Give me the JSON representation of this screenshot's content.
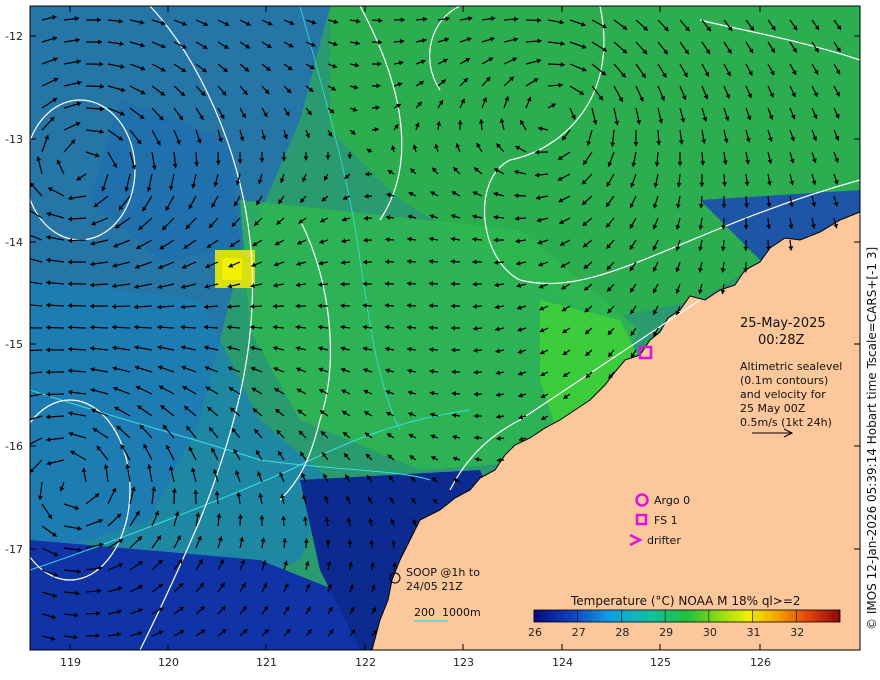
{
  "colors": {
    "land": "#fcc89b",
    "sst_low": "#0a2a8a",
    "sst_mid": "#2aa84a",
    "sst_high": "#e8e000",
    "contour": "#ffffff",
    "bathy": "#38e0e0",
    "marker": "#e010e0",
    "arrow": "#000000"
  },
  "axes": {
    "lat_ticks": [
      "-12",
      "-13",
      "-14",
      "-15",
      "-16",
      "-17"
    ],
    "lon_ticks": [
      "119",
      "120",
      "121",
      "122",
      "123",
      "124",
      "125",
      "126"
    ]
  },
  "stamp": {
    "date": "25-May-2025",
    "time": "00:28Z"
  },
  "altimetry_note": {
    "line1": "Altimetric sealevel",
    "line2": "(0.1m contours)",
    "line3": "and velocity for",
    "line4": "25 May 00Z",
    "scale": "0.5m/s (1kt 24h)"
  },
  "legend": {
    "argo": "Argo 0",
    "fs": "FS 1",
    "drifter": "drifter",
    "soop_line1": "SOOP @1h to",
    "soop_line2": "24/05 21Z",
    "bathy_200": "200",
    "bathy_1000": "1000m"
  },
  "colorbar": {
    "title": "Temperature (°C) NOAA  M 18% ql>=2",
    "ticks": [
      "26",
      "27",
      "28",
      "29",
      "30",
      "31",
      "32"
    ],
    "min": 26,
    "max": 33
  },
  "credit": "© IMOS 12-Jan-2026 05:39:14 Hobart time Tscale=CARS+[-1 3]"
}
